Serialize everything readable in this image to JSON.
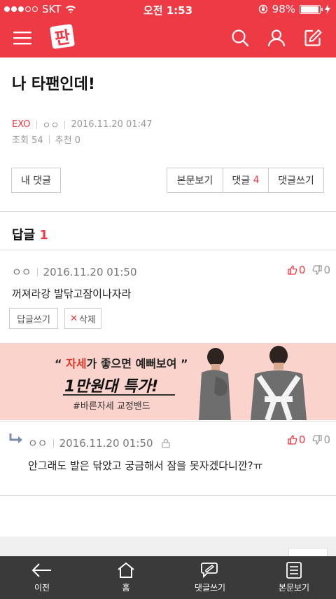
{
  "status_bar": {
    "carrier": "SKT",
    "time": "오전 1:53",
    "battery": "98%",
    "battery_level": 0.98
  },
  "header": {
    "logo_text": "판",
    "icons": [
      "menu-icon",
      "search-icon",
      "user-icon",
      "edit-icon"
    ]
  },
  "post": {
    "title": "나 타팬인데!",
    "category": "EXO",
    "author": "ㅇㅇ",
    "date": "2016.11.20 01:47",
    "views": "조회 54",
    "recommends": "추천 0"
  },
  "actions": {
    "my_comments": "내 댓글",
    "view_post": "본문보기",
    "comments_label": "댓글",
    "comments_count": "4",
    "write_comment": "댓글쓰기"
  },
  "replies": {
    "heading": "답글",
    "count": "1"
  },
  "comment1": {
    "author": "ㅇㅇ",
    "date": "2016.11.20 01:50",
    "up": "0",
    "down": "0",
    "text": "꺼져라강 발닦고잠이나자라",
    "reply_btn": "답글쓰기",
    "delete_btn": "삭제"
  },
  "ad": {
    "line1_pre": "“ ",
    "line1_red": "자세",
    "line1_rest": "가 좋으면 예뻐보여 ”",
    "line2": "1만원대 특가!",
    "line3": "#바른자세 교정밴드"
  },
  "comment2": {
    "author": "ㅇㅇ",
    "date": "2016.11.20 01:50",
    "up": "0",
    "down": "0",
    "text": "안그래도 발은 닦았고 궁금해서 잠을 못자겠다니깐?ㅠ"
  },
  "bottom_nav": {
    "back": "이전",
    "home": "홈",
    "write": "댓글쓰기",
    "view": "본문보기"
  },
  "colors": {
    "accent": "#ee3a44",
    "nav_bg": "#3a3a3a",
    "ad_bg": "#f9d3cc"
  }
}
